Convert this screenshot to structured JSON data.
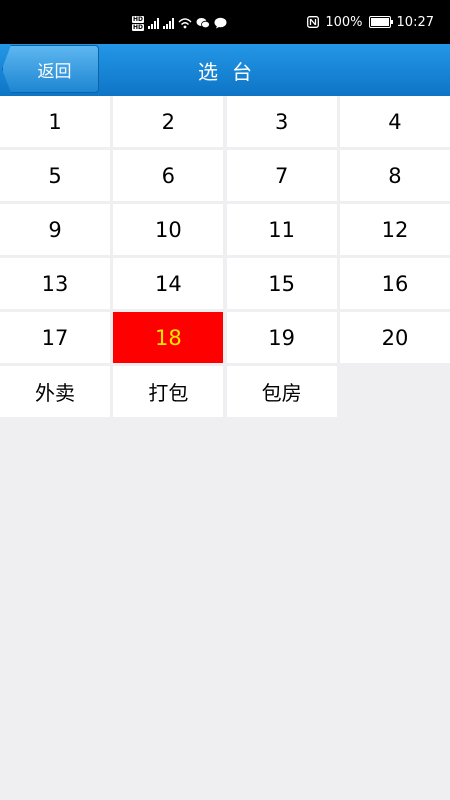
{
  "status_bar": {
    "hd1": "HD",
    "hd2": "HD",
    "net1": "5G",
    "net2": "4G",
    "battery": "100%",
    "battery_level": 1.0,
    "time": "10:27"
  },
  "header": {
    "back_label": "返回",
    "title": "选台"
  },
  "tables": [
    {
      "label": "1"
    },
    {
      "label": "2"
    },
    {
      "label": "3"
    },
    {
      "label": "4"
    },
    {
      "label": "5"
    },
    {
      "label": "6"
    },
    {
      "label": "7"
    },
    {
      "label": "8"
    },
    {
      "label": "9"
    },
    {
      "label": "10"
    },
    {
      "label": "11"
    },
    {
      "label": "12"
    },
    {
      "label": "13"
    },
    {
      "label": "14"
    },
    {
      "label": "15"
    },
    {
      "label": "16"
    },
    {
      "label": "17"
    },
    {
      "label": "18",
      "selected": true
    },
    {
      "label": "19"
    },
    {
      "label": "20"
    },
    {
      "label": "外卖"
    },
    {
      "label": "打包"
    },
    {
      "label": "包房"
    }
  ],
  "colors": {
    "selected_bg": "#ff0000",
    "selected_text": "#ffe500",
    "header_blue": "#1a87d6"
  }
}
